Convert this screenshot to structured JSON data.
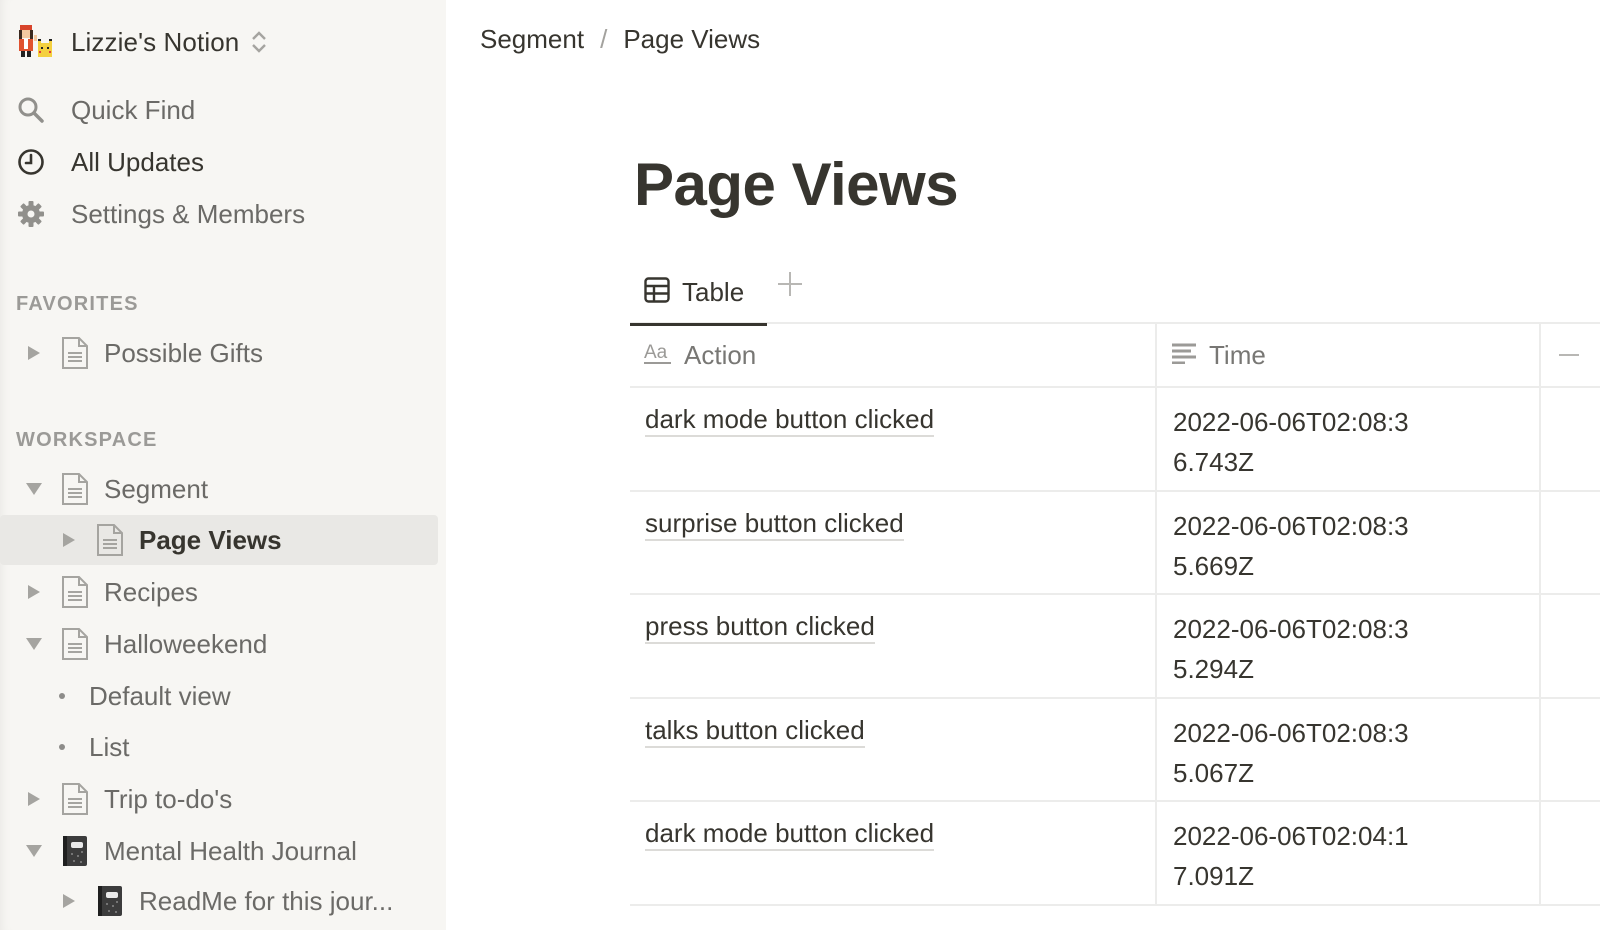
{
  "sidebar": {
    "workspace_name": "Lizzie's Notion",
    "workspace_avatar_icon": "pixel-avatar-with-pikachu",
    "nav": [
      {
        "label": "Quick Find",
        "icon": "search-icon"
      },
      {
        "label": "All Updates",
        "icon": "clock-icon"
      },
      {
        "label": "Settings & Members",
        "icon": "gear-icon"
      }
    ],
    "favorites_header": "FAVORITES",
    "favorites": [
      {
        "label": "Possible Gifts",
        "icon": "page-icon",
        "expanded": false
      }
    ],
    "workspace_header": "WORKSPACE",
    "workspace_items": [
      {
        "label": "Segment",
        "icon": "page-icon",
        "expanded": true,
        "depth": 0
      },
      {
        "label": "Page Views",
        "icon": "page-icon",
        "expanded": false,
        "depth": 1,
        "selected": true
      },
      {
        "label": "Recipes",
        "icon": "page-icon",
        "expanded": false,
        "depth": 0
      },
      {
        "label": "Halloweekend",
        "icon": "page-icon",
        "expanded": true,
        "depth": 0
      },
      {
        "label": "Default view",
        "type": "view",
        "depth": 1
      },
      {
        "label": "List",
        "type": "view",
        "depth": 1
      },
      {
        "label": "Trip to-do's",
        "icon": "page-icon",
        "expanded": false,
        "depth": 0
      },
      {
        "label": "Mental Health Journal",
        "icon": "notebook-icon",
        "expanded": true,
        "depth": 0
      },
      {
        "label": "ReadMe for this jour...",
        "icon": "notebook-icon",
        "expanded": false,
        "depth": 1
      }
    ]
  },
  "breadcrumb": [
    "Segment",
    "Page Views"
  ],
  "breadcrumb_separator": "/",
  "page": {
    "title": "Page Views",
    "views": [
      {
        "label": "Table",
        "icon": "table-icon",
        "active": true
      }
    ],
    "add_view_icon": "plus-icon",
    "table": {
      "columns": [
        {
          "label": "Action",
          "icon": "text-property-icon"
        },
        {
          "label": "Time",
          "icon": "text-lines-icon"
        }
      ],
      "add_column_icon": "plus-icon",
      "rows": [
        {
          "action": "dark mode button clicked",
          "time": "2022-06-06T02:08:36.743Z"
        },
        {
          "action": "surprise button clicked",
          "time": "2022-06-06T02:08:35.669Z"
        },
        {
          "action": "press button clicked",
          "time": "2022-06-06T02:08:35.294Z"
        },
        {
          "action": "talks button clicked",
          "time": "2022-06-06T02:08:35.067Z"
        },
        {
          "action": "dark mode button clicked",
          "time": "2022-06-06T02:04:17.091Z"
        }
      ]
    }
  },
  "colors": {
    "sidebar_bg": "#f7f6f3",
    "text_primary": "#37352f",
    "text_secondary": "#6b6a67",
    "selected_bg": "#e9e8e5",
    "border": "#ececeb"
  }
}
